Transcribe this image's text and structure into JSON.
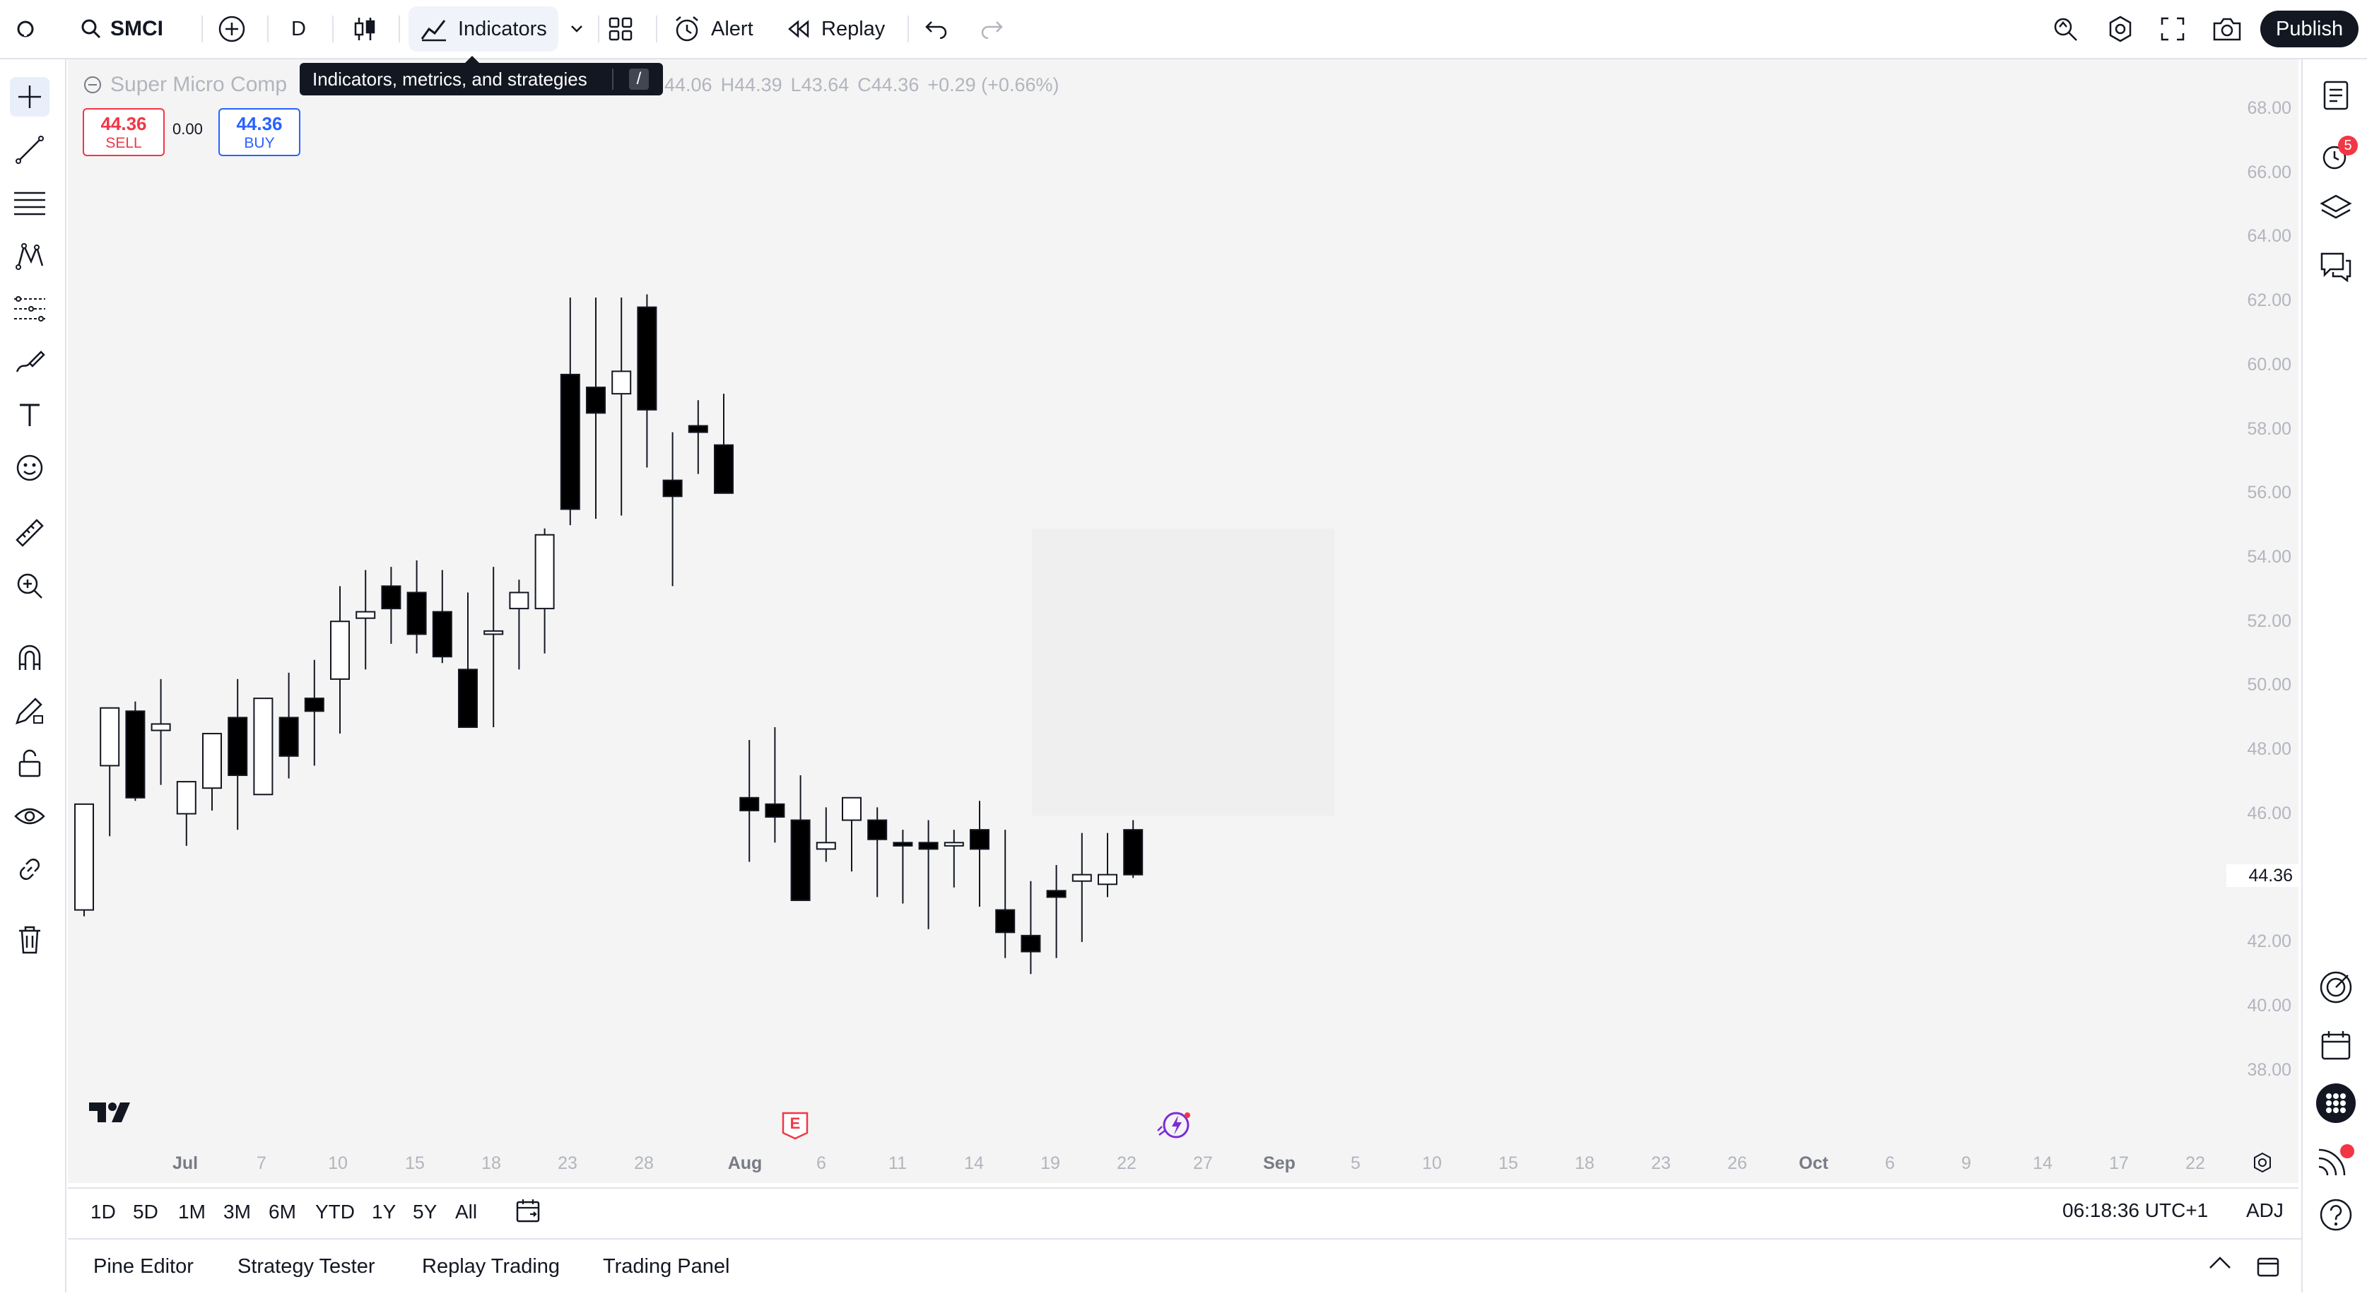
{
  "topbar": {
    "symbol": "SMCI",
    "interval": "D",
    "indicators_label": "Indicators",
    "alert_label": "Alert",
    "replay_label": "Replay",
    "publish_label": "Publish"
  },
  "tooltip": {
    "text": "Indicators, metrics, and strategies",
    "shortcut": "/"
  },
  "legend": {
    "name": "Super Micro Comp",
    "open": "44.06",
    "high_prefix": "H",
    "high": "44.39",
    "low_prefix": "L",
    "low": "43.64",
    "close_prefix": "C",
    "close": "44.36",
    "change": "+0.29 (+0.66%)"
  },
  "trade": {
    "sell_price": "44.36",
    "sell_label": "SELL",
    "spread": "0.00",
    "buy_price": "44.36",
    "buy_label": "BUY"
  },
  "current_price": "44.36",
  "price_labels": [
    "68.00",
    "66.00",
    "64.00",
    "62.00",
    "60.00",
    "58.00",
    "56.00",
    "54.00",
    "52.00",
    "50.00",
    "48.00",
    "46.00",
    "44.00",
    "42.00",
    "40.00",
    "38.00"
  ],
  "time_labels": [
    "Jul",
    "7",
    "10",
    "15",
    "18",
    "23",
    "28",
    "Aug",
    "6",
    "11",
    "14",
    "19",
    "22",
    "27",
    "Sep",
    "5",
    "10",
    "15",
    "18",
    "23",
    "26",
    "Oct",
    "6",
    "9",
    "14",
    "17",
    "22"
  ],
  "events": {
    "earnings_badge": "E"
  },
  "ranges": [
    "1D",
    "5D",
    "1M",
    "3M",
    "6M",
    "YTD",
    "1Y",
    "5Y",
    "All"
  ],
  "clock": "06:18:36 UTC+1",
  "adj_label": "ADJ",
  "alerts_badge": "5",
  "panels": [
    "Pine Editor",
    "Strategy Tester",
    "Replay Trading",
    "Trading Panel"
  ],
  "colors": {
    "up_fill": "#ffffff",
    "down_fill": "#000000",
    "sell": "#f23645",
    "buy": "#2962ff",
    "chart_bg": "#f4f4f4"
  },
  "chart_data": {
    "type": "candlestick",
    "symbol": "SMCI",
    "interval": "D",
    "ylim": [
      37,
      69
    ],
    "x": [
      "Jun 28",
      "Jul 1",
      "Jul 2",
      "Jul 3",
      "Jul 5",
      "Jul 8",
      "Jul 9",
      "Jul 10",
      "Jul 11",
      "Jul 12",
      "Jul 15",
      "Jul 16",
      "Jul 17",
      "Jul 18",
      "Jul 19",
      "Jul 22",
      "Jul 23",
      "Jul 24",
      "Jul 25",
      "Jul 26",
      "Jul 29",
      "Jul 30",
      "Jul 31",
      "Aug 1",
      "Aug 2",
      "Aug 5",
      "Aug 6",
      "Aug 7",
      "Aug 8",
      "Aug 9",
      "Aug 12",
      "Aug 13",
      "Aug 14",
      "Aug 15",
      "Aug 16",
      "Aug 19",
      "Aug 20",
      "Aug 21",
      "Aug 22",
      "Aug 23",
      "Aug 26",
      "Aug 27",
      "Aug 28",
      "Aug 29",
      "Aug 30",
      "Sep 3",
      "Sep 4"
    ],
    "open": [
      43.3,
      47.8,
      49.5,
      48.9,
      46.3,
      47.1,
      49.3,
      46.9,
      49.3,
      49.9,
      50.5,
      52.4,
      53.4,
      53.2,
      52.6,
      50.8,
      51.9,
      52.7,
      52.7,
      60.0,
      59.6,
      59.4,
      62.1,
      56.7,
      58.4,
      57.8,
      46.8,
      46.6,
      46.1,
      45.2,
      46.1,
      46.1,
      45.4,
      45.4,
      45.3,
      45.8,
      43.3,
      42.5,
      43.9,
      44.2,
      44.1,
      45.8,
      null,
      null,
      null,
      null,
      null
    ],
    "high": [
      45.2,
      48.4,
      49.8,
      50.5,
      46.9,
      48.8,
      50.5,
      48.8,
      50.7,
      51.1,
      53.4,
      53.9,
      54.0,
      54.2,
      53.9,
      53.2,
      54.0,
      53.6,
      55.2,
      62.4,
      62.4,
      62.4,
      62.5,
      58.2,
      59.2,
      59.4,
      48.6,
      49.0,
      47.5,
      46.5,
      46.2,
      46.5,
      45.8,
      46.1,
      45.8,
      46.7,
      45.8,
      44.2,
      44.7,
      45.7,
      45.7,
      46.1,
      null,
      null,
      null,
      null,
      null
    ],
    "low": [
      43.1,
      45.6,
      46.7,
      47.2,
      45.3,
      46.4,
      45.8,
      47.5,
      47.4,
      47.8,
      48.8,
      50.8,
      51.6,
      51.3,
      51.0,
      49.9,
      49.0,
      50.8,
      51.3,
      55.3,
      55.5,
      55.6,
      57.1,
      53.4,
      56.9,
      56.8,
      44.8,
      45.4,
      45.5,
      44.8,
      44.5,
      43.7,
      43.5,
      42.7,
      44.0,
      43.4,
      41.8,
      41.3,
      41.8,
      42.3,
      43.7,
      44.3,
      null,
      null,
      null,
      null,
      null
    ],
    "close": [
      46.6,
      49.6,
      46.8,
      49.1,
      47.3,
      48.8,
      47.5,
      49.9,
      48.1,
      49.5,
      52.3,
      52.6,
      52.7,
      51.9,
      51.2,
      49.0,
      52.0,
      53.2,
      55.0,
      55.8,
      58.8,
      60.1,
      58.9,
      56.2,
      58.2,
      56.3,
      46.4,
      46.2,
      43.6,
      45.4,
      46.8,
      45.5,
      45.3,
      45.2,
      45.4,
      45.2,
      42.6,
      42.0,
      43.7,
      44.4,
      44.4,
      44.4,
      null,
      null,
      null,
      null,
      null
    ]
  }
}
